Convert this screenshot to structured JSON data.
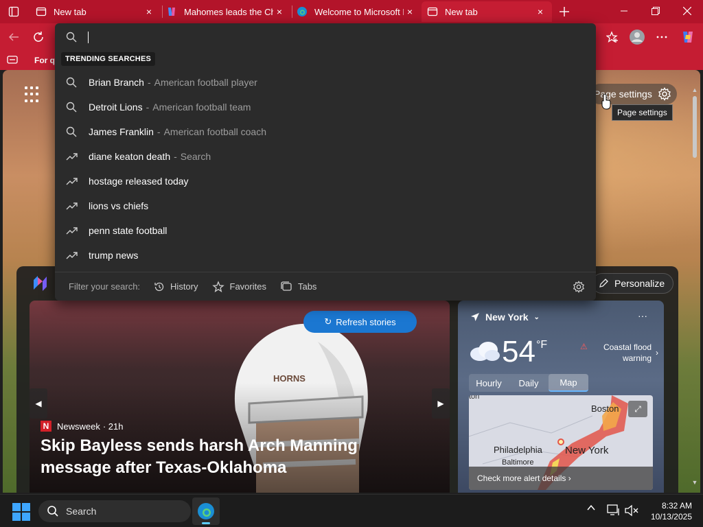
{
  "tabs": [
    {
      "label": "New tab",
      "close": "×"
    },
    {
      "label": "Mahomes leads the Chie",
      "close": "×"
    },
    {
      "label": "Welcome to Microsoft E",
      "close": "×"
    },
    {
      "label": "New tab",
      "close": "×"
    }
  ],
  "favorites_bar": {
    "item": "For q"
  },
  "page": {
    "settings_label": "Page settings",
    "tooltip": "Page settings"
  },
  "search": {
    "value": "",
    "trending_label": "TRENDING SEARCHES",
    "suggestions": [
      {
        "icon": "search-icon",
        "text": "Brian Branch",
        "sub": "American football player",
        "sep": "-"
      },
      {
        "icon": "search-icon",
        "text": "Detroit Lions",
        "sub": "American football team",
        "sep": "-"
      },
      {
        "icon": "search-icon",
        "text": "James Franklin",
        "sub": "American football coach",
        "sep": "-"
      },
      {
        "icon": "trending-icon",
        "text": "diane keaton death",
        "sub": "Search",
        "sep": "-"
      },
      {
        "icon": "trending-icon",
        "text": "hostage released today",
        "sub": "",
        "sep": ""
      },
      {
        "icon": "trending-icon",
        "text": "lions vs chiefs",
        "sub": "",
        "sep": ""
      },
      {
        "icon": "trending-icon",
        "text": "penn state football",
        "sub": "",
        "sep": ""
      },
      {
        "icon": "trending-icon",
        "text": "trump news",
        "sub": "",
        "sep": ""
      }
    ],
    "filter": {
      "label": "Filter your search:",
      "history": "History",
      "favorites": "Favorites",
      "tabs": "Tabs"
    }
  },
  "feed": {
    "personalize": "Personalize",
    "refresh": "Refresh stories",
    "hero": {
      "source": "Newsweek",
      "source_logo": "N",
      "age": "· 21h",
      "headline": "Skip Bayless sends harsh Arch Manning message after Texas-Oklahoma",
      "helmet_text": "HORNS"
    }
  },
  "weather": {
    "location": "New York",
    "more": "···",
    "temp": "54",
    "unit": "°F",
    "alert": "Coastal flood warning",
    "tabs": [
      "Hourly",
      "Daily",
      "Map"
    ],
    "selected_tab": "Map",
    "map_cities": [
      "Boston",
      "Philadelphia",
      "Baltimore",
      "New York"
    ],
    "map_partial": "ton",
    "alert_link": "Check more alert details ›"
  },
  "taskbar": {
    "search": "Search",
    "time": "8:32 AM",
    "date": "10/13/2025"
  },
  "colors": {
    "title_bar": "#b3142a",
    "toolbar": "#c51d33",
    "accent_blue": "#1b77d1",
    "alert_red": "#ff5a5a"
  }
}
